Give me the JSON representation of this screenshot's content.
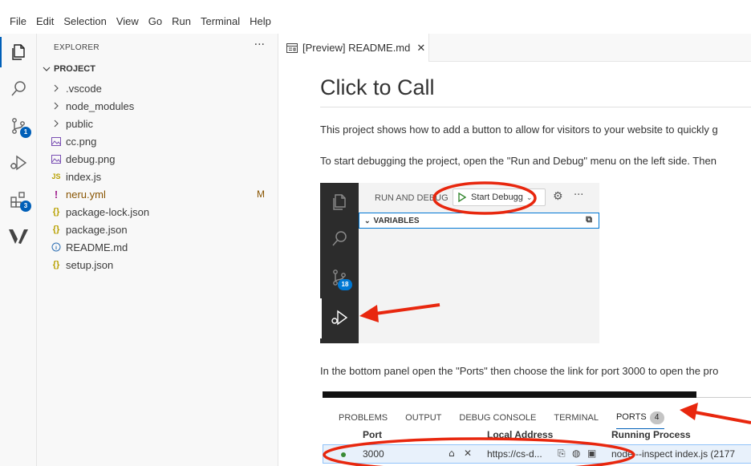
{
  "menubar": {
    "items": [
      "File",
      "Edit",
      "Selection",
      "View",
      "Go",
      "Run",
      "Terminal",
      "Help"
    ]
  },
  "activitybar": {
    "icons": [
      "files-icon",
      "search-icon",
      "source-control-icon",
      "run-debug-icon",
      "extensions-icon",
      "vonage-icon"
    ],
    "source_control_badge": "1",
    "extensions_badge": "3"
  },
  "sidebar": {
    "header": "EXPLORER",
    "more": "···",
    "section": "PROJECT",
    "items": [
      {
        "label": ".vscode",
        "kind": "folder"
      },
      {
        "label": "node_modules",
        "kind": "folder"
      },
      {
        "label": "public",
        "kind": "folder"
      },
      {
        "label": "cc.png",
        "kind": "image"
      },
      {
        "label": "debug.png",
        "kind": "image"
      },
      {
        "label": "index.js",
        "kind": "js"
      },
      {
        "label": "neru.yml",
        "kind": "yml",
        "status": "M"
      },
      {
        "label": "package-lock.json",
        "kind": "json"
      },
      {
        "label": "package.json",
        "kind": "json"
      },
      {
        "label": "README.md",
        "kind": "info"
      },
      {
        "label": "setup.json",
        "kind": "json"
      }
    ]
  },
  "tab": {
    "label": "[Preview] README.md",
    "close": "✕"
  },
  "document": {
    "title": "Click to Call",
    "para1": "This project shows how to add a button to allow for visitors to your website to quickly g",
    "para2": "To start debugging the project, open the \"Run and Debug\" menu on the left side. Then",
    "para3": "In the bottom panel open the \"Ports\" then choose the link for port 3000 to open the pro"
  },
  "screenshot1": {
    "run_label": "RUN AND DEBUG",
    "start_button": "Start Debugg",
    "variables": "VARIABLES",
    "badge": "18"
  },
  "screenshot2": {
    "tabs": [
      "PROBLEMS",
      "OUTPUT",
      "DEBUG CONSOLE",
      "TERMINAL",
      "PORTS"
    ],
    "ports_count": "4",
    "headers": {
      "port": "Port",
      "address": "Local Address",
      "process": "Running Process"
    },
    "row": {
      "port": "3000",
      "address": "https://cs-d...",
      "process": "node --inspect index.js (2177"
    }
  },
  "colors": {
    "accent": "#005fb8",
    "annotation": "#e8270e",
    "modified": "#895503"
  }
}
